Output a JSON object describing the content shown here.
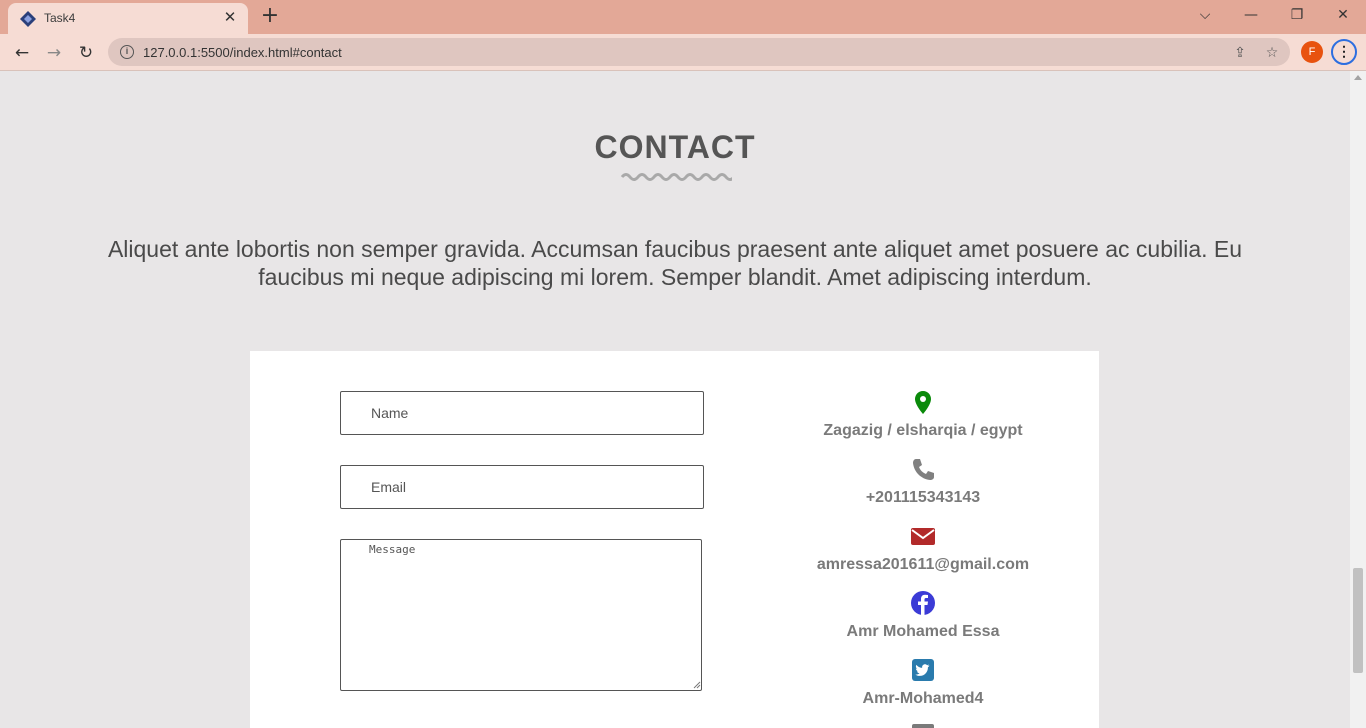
{
  "browser": {
    "tab_title": "Task4",
    "tab_close": "✕",
    "new_tab": "+",
    "url": "127.0.0.1:5500/index.html#contact",
    "profile_initial": "F",
    "window_controls": {
      "dropdown": "⌵",
      "minimize": "—",
      "restore": "❐",
      "close": "✕"
    },
    "nav": {
      "back": "←",
      "forward": "→",
      "reload": "↻"
    },
    "info_glyph": "i",
    "share_glyph": "⇪",
    "star_glyph": "☆",
    "menu_glyph": "⋮"
  },
  "contact": {
    "title": "CONTACT",
    "intro": "Aliquet ante lobortis non semper gravida. Accumsan faucibus praesent ante aliquet amet posuere ac cubilia. Eu faucibus mi neque adipiscing mi lorem. Semper blandit. Amet adipiscing interdum.",
    "form": {
      "name_placeholder": "Name",
      "email_placeholder": "Email",
      "message_placeholder": "Message"
    },
    "info": {
      "location": "Zagazig / elsharqia / egypt",
      "phone": "+201115343143",
      "email": "amressa201611@gmail.com",
      "facebook": "Amr Mohamed Essa",
      "twitter": "Amr-Mohamed4"
    }
  },
  "colors": {
    "titlebar": "#e3a897",
    "toolbar": "#f6dcd4",
    "page_bg": "#e8e6e7",
    "location_icon": "#0a8a0a",
    "phone_icon": "#808080",
    "email_icon": "#b22a2a",
    "facebook_icon": "#3b3bd6",
    "twitter_icon": "#2a7bad"
  }
}
